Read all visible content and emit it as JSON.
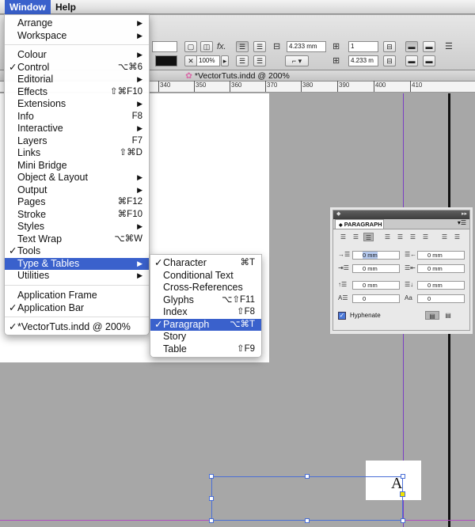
{
  "menubar": {
    "items": [
      {
        "label": "Window"
      },
      {
        "label": "Help"
      }
    ]
  },
  "control_panel": {
    "stroke_weight": "1",
    "spacing_top": "4.233 mm",
    "spacing_bottom": "4.233 m",
    "columns": "1",
    "zoom_value": "100%"
  },
  "document": {
    "tab_title": "*VectorTuts.indd @ 200%",
    "ruler_labels": [
      "340",
      "350",
      "360",
      "370",
      "380",
      "390",
      "400",
      "410"
    ]
  },
  "canvas": {
    "glyph": "A"
  },
  "window_menu": {
    "items": [
      {
        "label": "Arrange",
        "shortcut": "",
        "check": "",
        "arrow": "▶"
      },
      {
        "label": "Workspace",
        "shortcut": "",
        "check": "",
        "arrow": "▶"
      },
      {
        "label": "Colour",
        "shortcut": "",
        "check": "",
        "arrow": "▶"
      },
      {
        "label": "Control",
        "shortcut": "⌥⌘6",
        "check": "✓",
        "arrow": ""
      },
      {
        "label": "Editorial",
        "shortcut": "",
        "check": "",
        "arrow": "▶"
      },
      {
        "label": "Effects",
        "shortcut": "⇧⌘F10",
        "check": "",
        "arrow": ""
      },
      {
        "label": "Extensions",
        "shortcut": "",
        "check": "",
        "arrow": "▶"
      },
      {
        "label": "Info",
        "shortcut": "F8",
        "check": "",
        "arrow": ""
      },
      {
        "label": "Interactive",
        "shortcut": "",
        "check": "",
        "arrow": "▶"
      },
      {
        "label": "Layers",
        "shortcut": "F7",
        "check": "",
        "arrow": ""
      },
      {
        "label": "Links",
        "shortcut": "⇧⌘D",
        "check": "",
        "arrow": ""
      },
      {
        "label": "Mini Bridge",
        "shortcut": "",
        "check": "",
        "arrow": ""
      },
      {
        "label": "Object & Layout",
        "shortcut": "",
        "check": "",
        "arrow": "▶"
      },
      {
        "label": "Output",
        "shortcut": "",
        "check": "",
        "arrow": "▶"
      },
      {
        "label": "Pages",
        "shortcut": "⌘F12",
        "check": "",
        "arrow": ""
      },
      {
        "label": "Stroke",
        "shortcut": "⌘F10",
        "check": "",
        "arrow": ""
      },
      {
        "label": "Styles",
        "shortcut": "",
        "check": "",
        "arrow": "▶"
      },
      {
        "label": "Text Wrap",
        "shortcut": "⌥⌘W",
        "check": "",
        "arrow": ""
      },
      {
        "label": "Tools",
        "shortcut": "",
        "check": "✓",
        "arrow": ""
      },
      {
        "label": "Type & Tables",
        "shortcut": "",
        "check": "",
        "arrow": "▶"
      },
      {
        "label": "Utilities",
        "shortcut": "",
        "check": "",
        "arrow": "▶"
      },
      {
        "label": "Application Frame",
        "shortcut": "",
        "check": "",
        "arrow": ""
      },
      {
        "label": "Application Bar",
        "shortcut": "",
        "check": "✓",
        "arrow": ""
      },
      {
        "label": "*VectorTuts.indd @ 200%",
        "shortcut": "",
        "check": "✓",
        "arrow": ""
      }
    ]
  },
  "type_submenu": {
    "items": [
      {
        "label": "Character",
        "shortcut": "⌘T",
        "check": "✓"
      },
      {
        "label": "Conditional Text",
        "shortcut": "",
        "check": ""
      },
      {
        "label": "Cross-References",
        "shortcut": "",
        "check": ""
      },
      {
        "label": "Glyphs",
        "shortcut": "⌥⇧F11",
        "check": ""
      },
      {
        "label": "Index",
        "shortcut": "⇧F8",
        "check": ""
      },
      {
        "label": "Paragraph",
        "shortcut": "⌥⌘T",
        "check": "✓"
      },
      {
        "label": "Story",
        "shortcut": "",
        "check": ""
      },
      {
        "label": "Table",
        "shortcut": "⇧F9",
        "check": ""
      }
    ]
  },
  "paragraph_panel": {
    "title": "PARAGRAPH",
    "left_indent": "0 mm",
    "right_indent": "0 mm",
    "first_line_indent": "0 mm",
    "last_line_indent": "0 mm",
    "space_before": "0 mm",
    "space_after": "0 mm",
    "drop_cap_lines": "0",
    "drop_cap_chars": "0",
    "hyphenate_label": "Hyphenate",
    "hyphenate_checked": true
  },
  "colors": {
    "menu_highlight": "#3a61cc",
    "guide": "#7b3fc4",
    "frame": "#4a6fd6"
  }
}
